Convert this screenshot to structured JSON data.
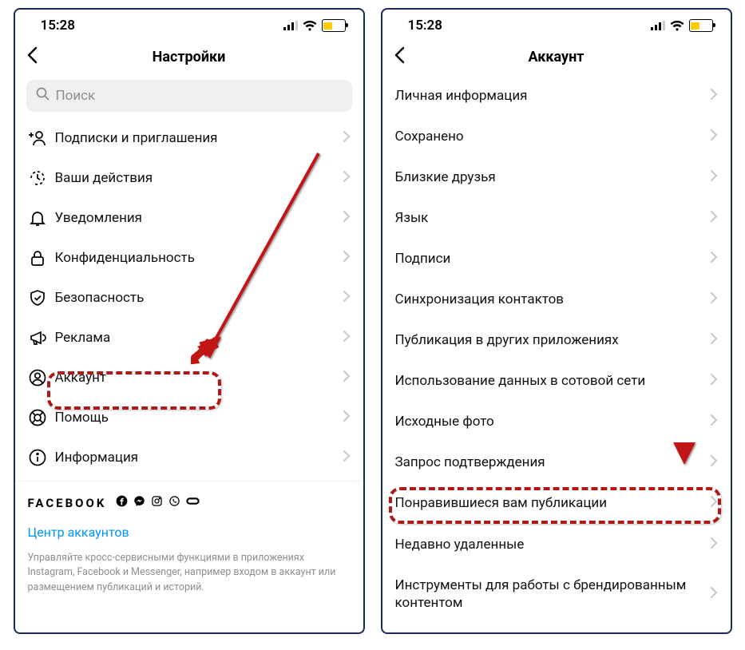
{
  "status": {
    "time": "15:28"
  },
  "left": {
    "title": "Настройки",
    "search_placeholder": "Поиск",
    "items": [
      {
        "label": "Подписки и приглашения"
      },
      {
        "label": "Ваши действия"
      },
      {
        "label": "Уведомления"
      },
      {
        "label": "Конфиденциальность"
      },
      {
        "label": "Безопасность"
      },
      {
        "label": "Реклама"
      },
      {
        "label": "Аккаунт"
      },
      {
        "label": "Помощь"
      },
      {
        "label": "Информация"
      }
    ],
    "brand": "FACEBOOK",
    "center_link": "Центр аккаунтов",
    "hint": "Управляйте кросс-сервисными функциями в приложениях Instagram, Facebook и Messenger, например входом в аккаунт или размещением публикаций и историй."
  },
  "right": {
    "title": "Аккаунт",
    "items": [
      {
        "label": "Личная информация"
      },
      {
        "label": "Сохранено"
      },
      {
        "label": "Близкие друзья"
      },
      {
        "label": "Язык"
      },
      {
        "label": "Подписи"
      },
      {
        "label": "Синхронизация контактов"
      },
      {
        "label": "Публикация в других приложениях"
      },
      {
        "label": "Использование данных в сотовой сети"
      },
      {
        "label": "Исходные фото"
      },
      {
        "label": "Запрос подтверждения"
      },
      {
        "label": "Понравившиеся вам публикации"
      },
      {
        "label": "Недавно удаленные"
      },
      {
        "label": "Инструменты для работы с брендированным контентом"
      }
    ]
  }
}
